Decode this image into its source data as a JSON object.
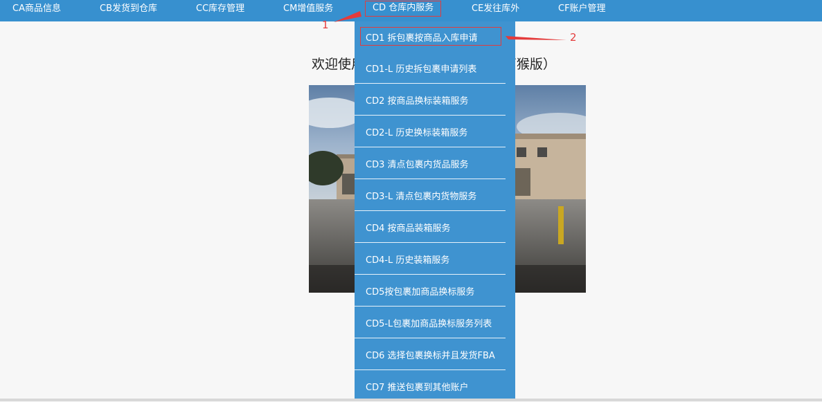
{
  "nav": {
    "items": [
      {
        "label": "CA商品信息"
      },
      {
        "label": "CB发货到仓库"
      },
      {
        "label": "CC库存管理"
      },
      {
        "label": "CM增值服务"
      },
      {
        "label": "CD 仓库内服务"
      },
      {
        "label": "CE发往库外"
      },
      {
        "label": "CF账户管理"
      }
    ],
    "active_index": 4
  },
  "main": {
    "welcome_text": "欢迎使用QQ快递西海外仓系统（石猴版）"
  },
  "dropdown": {
    "items": [
      {
        "label": "CD1 拆包裹按商品入库申请"
      },
      {
        "label": "CD1-L 历史拆包裹申请列表"
      },
      {
        "label": "CD2 按商品换标装箱服务"
      },
      {
        "label": "CD2-L 历史换标装箱服务"
      },
      {
        "label": "CD3 清点包裹内货品服务"
      },
      {
        "label": "CD3-L 清点包裹内货物服务"
      },
      {
        "label": "CD4 按商品装箱服务"
      },
      {
        "label": "CD4-L 历史装箱服务"
      },
      {
        "label": "CD5按包裹加商品换标服务"
      },
      {
        "label": "CD5-L包裹加商品换标服务列表"
      },
      {
        "label": "CD6 选择包裹换标并且发货FBA"
      },
      {
        "label": "CD7 推送包裹到其他账户"
      }
    ]
  },
  "annotations": {
    "marker_1": "1",
    "marker_2": "2"
  },
  "colors": {
    "topbar": "#3790cf",
    "dropdown": "#3f93d0",
    "annotation": "#e43b3b"
  }
}
